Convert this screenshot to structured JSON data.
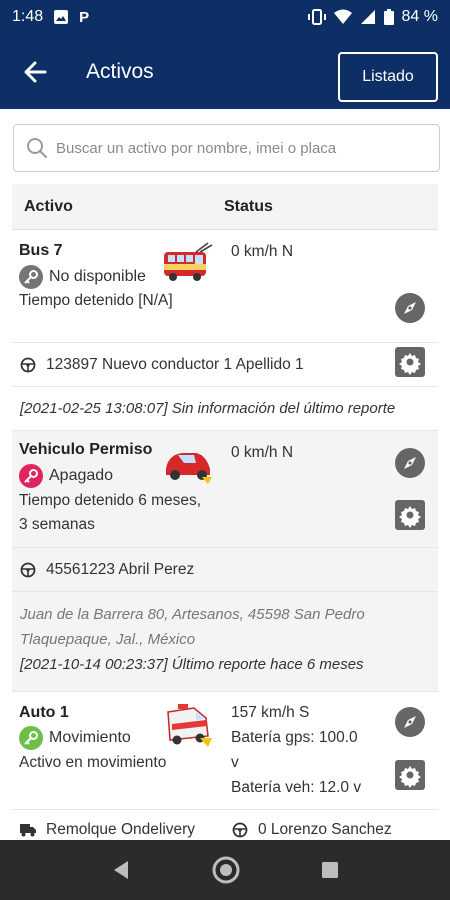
{
  "status_bar": {
    "time": "1:48",
    "battery": "84 %"
  },
  "app_bar": {
    "title": "Activos",
    "listado_label": "Listado"
  },
  "search": {
    "placeholder": "Buscar un activo por nombre, imei o placa"
  },
  "table": {
    "col_activo": "Activo",
    "col_status": "Status"
  },
  "colors": {
    "primary": "#0e2e66",
    "key_grey": "#757575",
    "key_red": "#e0245e",
    "key_green": "#6cc04a"
  },
  "assets": [
    {
      "name": "Bus 7",
      "state": "No disponible",
      "state_color": "grey",
      "icon": "trolley-bus-icon",
      "detail_1": "Tiempo detenido [N/A]",
      "detail_2": "",
      "speed": "0 km/h N",
      "driver": "123897 Nuevo conductor 1 Apellido 1",
      "report": "[2021-02-25 13:08:07] Sin información del último reporte"
    },
    {
      "name": "Vehiculo Permiso",
      "state": "Apagado",
      "state_color": "red",
      "icon": "red-car-icon",
      "detail_1": "Tiempo detenido 6 meses,",
      "detail_2": "3 semanas",
      "speed": "0 km/h N",
      "driver": "45561223 Abril Perez",
      "address_1": "Juan de la Barrera 80, Artesanos, 45598 San Pedro",
      "address_2": "Tlaquepaque, Jal., México",
      "report": "[2021-10-14 00:23:37] Último reporte hace 6 meses"
    },
    {
      "name": "Auto 1",
      "state": "Movimiento",
      "state_color": "green",
      "icon": "ambulance-icon",
      "detail_1": "Activo en movimiento",
      "speed": "157 km/h S",
      "battery_gps": "Batería gps: 100.0",
      "battery_gps_unit": "v",
      "battery_veh": "Batería veh: 12.0 v",
      "trailer": "Remolque Ondelivery",
      "driver": "0 Lorenzo Sanchez"
    }
  ]
}
